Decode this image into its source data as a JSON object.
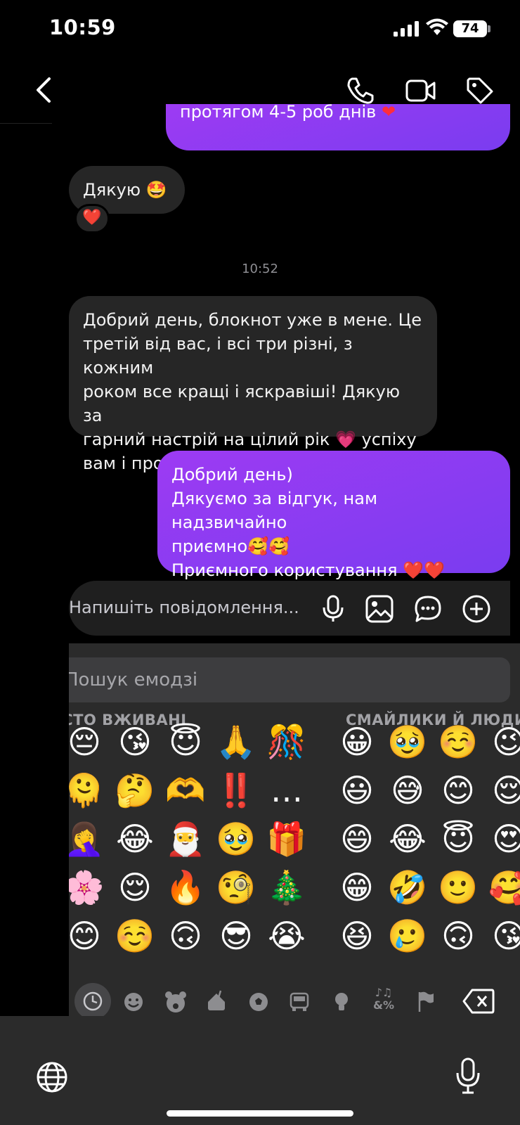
{
  "status_bar": {
    "time": "10:59",
    "battery": "74"
  },
  "header": {
    "back_icon": "chevron-left-icon",
    "actions": [
      "phone-icon",
      "video-icon",
      "tag-icon"
    ]
  },
  "messages": {
    "top_partial": "протягом 4-5 роб днів",
    "thanks": "Дякую",
    "thanks_reaction": "❤️",
    "timestamp": "10:52",
    "review_lines": [
      "Добрий день, блокнот уже в мене. Це",
      "третій від вас, і всі три різні, з кожним",
      "роком все кращі і яскравіші! Дякую за",
      "гарний настрій на цілий рік 💗  успіху",
      "вам і процвітання!"
    ],
    "reply_lines": [
      "Добрий день)",
      "Дякуємо за відгук, нам надзвичайно",
      "приємно🥰🥰",
      "Приємного користування ❤️❤️"
    ]
  },
  "composer": {
    "placeholder": "Напишіть повідомлення...",
    "icons": [
      "microphone-icon",
      "image-icon",
      "sticker-icon",
      "plus-circle-icon"
    ]
  },
  "emoji_keyboard": {
    "search_placeholder": "Пошук емодзі",
    "section_recent": "ЧАСТО ВЖИВАНІ",
    "section_smileys": "СМАЙЛИКИ Й ЛЮДИ",
    "recent": [
      [
        "😔",
        "😘",
        "😇",
        "🙏",
        "🎊"
      ],
      [
        "🫠",
        "🤔",
        "🫶",
        "‼️",
        "…"
      ],
      [
        "🤦‍♀️",
        "😂",
        "🎅",
        "🥹",
        "🎁"
      ],
      [
        "🌸",
        "😌",
        "🔥",
        "🧐",
        "🎄"
      ],
      [
        "😊",
        "☺️",
        "🙃",
        "😎",
        "😭"
      ]
    ],
    "smileys": [
      [
        "😀",
        "🥹",
        "☺️",
        "😉"
      ],
      [
        "😃",
        "😅",
        "😊",
        "😌"
      ],
      [
        "😄",
        "😂",
        "😇",
        "😍"
      ],
      [
        "😁",
        "🤣",
        "🙂",
        "🥰"
      ],
      [
        "😆",
        "🥲",
        "🙃",
        "😘"
      ]
    ],
    "categories": [
      "clock-icon",
      "smiley-icon",
      "bear-icon",
      "food-icon",
      "ball-icon",
      "car-icon",
      "bulb-icon",
      "symbols-icon",
      "flag-icon"
    ],
    "category_symbols_label": "&%",
    "delete_icon": "backspace-icon"
  },
  "system_bar": {
    "globe_icon": "globe-icon",
    "dictation_icon": "microphone-icon"
  },
  "colors": {
    "outgoing": "#8b3cf2",
    "incoming": "#262626",
    "background": "#000000"
  }
}
